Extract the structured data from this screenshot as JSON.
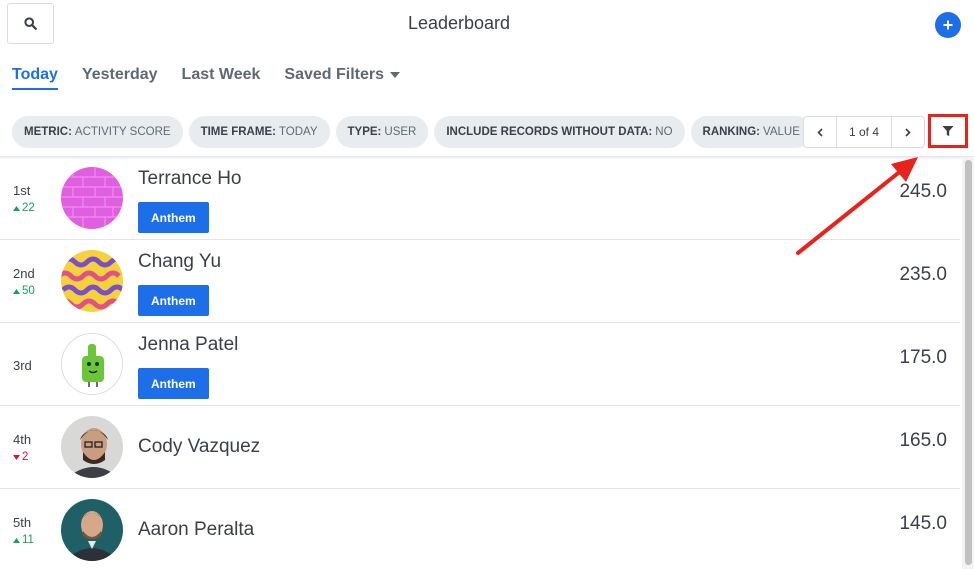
{
  "header": {
    "title": "Leaderboard",
    "search_icon": "search-icon",
    "add_icon": "plus-circle-icon"
  },
  "tabs": [
    {
      "label": "Today",
      "active": true
    },
    {
      "label": "Yesterday",
      "active": false
    },
    {
      "label": "Last Week",
      "active": false
    },
    {
      "label": "Saved Filters",
      "active": false,
      "icon": "caret-down-icon"
    }
  ],
  "filters": [
    {
      "key": "METRIC:",
      "value": "Activity Score"
    },
    {
      "key": "TIME FRAME:",
      "value": "Today"
    },
    {
      "key": "TYPE:",
      "value": "User"
    },
    {
      "key": "INCLUDE RECORDS WITHOUT DATA:",
      "value": "No"
    },
    {
      "key": "RANKING:",
      "value": "Value"
    }
  ],
  "pager": {
    "label": "1 of 4",
    "prev_icon": "chevron-left-icon",
    "next_icon": "chevron-right-icon"
  },
  "filter_button": {
    "icon": "filter-icon"
  },
  "rows": [
    {
      "rank": "1st",
      "delta": "22",
      "trend": "up",
      "name": "Terrance Ho",
      "team": "Anthem",
      "score": "245.0",
      "avatar": "pink-brick-avatar"
    },
    {
      "rank": "2nd",
      "delta": "50",
      "trend": "up",
      "name": "Chang Yu",
      "team": "Anthem",
      "score": "235.0",
      "avatar": "yellow-pattern-avatar"
    },
    {
      "rank": "3rd",
      "delta": "",
      "trend": "none",
      "name": "Jenna Patel",
      "team": "Anthem",
      "score": "175.0",
      "avatar": "green-thumbs-up-avatar"
    },
    {
      "rank": "4th",
      "delta": "2",
      "trend": "down",
      "name": "Cody Vazquez",
      "team": "",
      "score": "165.0",
      "avatar": "photo-avatar"
    },
    {
      "rank": "5th",
      "delta": "11",
      "trend": "up",
      "name": "Aaron Peralta",
      "team": "",
      "score": "145.0",
      "avatar": "photo-avatar"
    }
  ],
  "colors": {
    "accent": "#1c6fe8",
    "up": "#19a05a",
    "down": "#d8183a",
    "annotation": "#e8231e"
  }
}
